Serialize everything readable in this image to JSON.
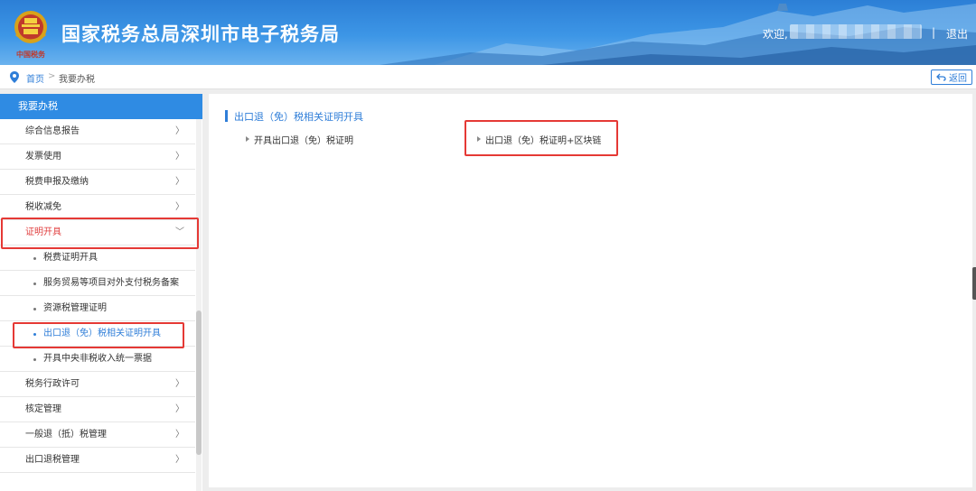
{
  "header": {
    "site_title": "国家税务总局深圳市电子税务局",
    "emblem_text": "中国税务",
    "welcome": "欢迎,",
    "separator": "|",
    "logout": "退出"
  },
  "breadcrumb": {
    "home": "首页",
    "separator": ">",
    "current": "我要办税",
    "back_label": "返回"
  },
  "sidebar": {
    "title": "我要办税",
    "items": [
      {
        "label": "综合信息报告",
        "chevron": "〉"
      },
      {
        "label": "发票使用",
        "chevron": "〉"
      },
      {
        "label": "税费申报及缴纳",
        "chevron": "〉"
      },
      {
        "label": "税收减免",
        "chevron": "〉"
      },
      {
        "label": "证明开具",
        "chevron": "﹀"
      },
      {
        "label": "税费证明开具"
      },
      {
        "label": "服务贸易等项目对外支付税务备案"
      },
      {
        "label": "资源税管理证明"
      },
      {
        "label": "出口退（免）税相关证明开具"
      },
      {
        "label": "开具中央非税收入统一票据"
      },
      {
        "label": "税务行政许可",
        "chevron": "〉"
      },
      {
        "label": "核定管理",
        "chevron": "〉"
      },
      {
        "label": "一般退（抵）税管理",
        "chevron": "〉"
      },
      {
        "label": "出口退税管理",
        "chevron": "〉"
      }
    ]
  },
  "main": {
    "section_title": "出口退（免）税相关证明开具",
    "links": [
      {
        "label": "开具出口退（免）税证明"
      },
      {
        "label": "出口退（免）税证明+区块链"
      }
    ]
  },
  "colors": {
    "accent": "#2f7ed8",
    "highlight": "#e53935",
    "header": "#3d96e6"
  }
}
